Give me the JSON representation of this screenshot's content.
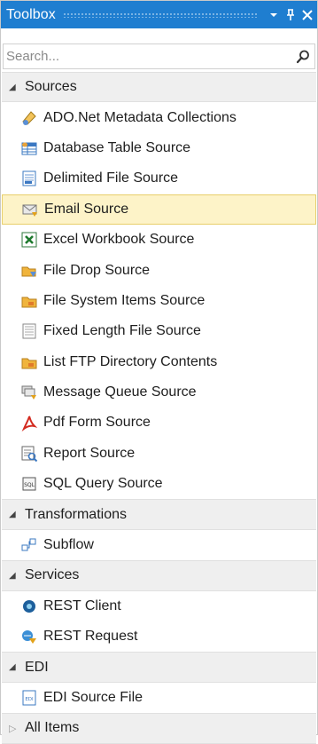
{
  "window": {
    "title": "Toolbox",
    "pin_glyph": "⭱",
    "close_glyph": "✕"
  },
  "search": {
    "placeholder": "Search..."
  },
  "colors": {
    "titlebar": "#1f7ed0",
    "selected_bg": "#fdf3c8",
    "group_bg": "#efefef"
  },
  "groups": {
    "sources": {
      "label": "Sources",
      "items": [
        {
          "label": "ADO.Net Metadata Collections",
          "icon": "ado-net-icon"
        },
        {
          "label": "Database Table Source",
          "icon": "database-table-icon"
        },
        {
          "label": "Delimited File Source",
          "icon": "delimited-file-icon"
        },
        {
          "label": "Email Source",
          "icon": "email-icon",
          "selected": true
        },
        {
          "label": "Excel Workbook Source",
          "icon": "excel-icon"
        },
        {
          "label": "File Drop Source",
          "icon": "file-drop-icon"
        },
        {
          "label": "File System Items Source",
          "icon": "folder-icon"
        },
        {
          "label": "Fixed Length File Source",
          "icon": "fixed-length-file-icon"
        },
        {
          "label": "List FTP Directory Contents",
          "icon": "ftp-folder-icon"
        },
        {
          "label": "Message Queue Source",
          "icon": "message-queue-icon"
        },
        {
          "label": "Pdf Form Source",
          "icon": "pdf-icon"
        },
        {
          "label": "Report Source",
          "icon": "report-icon"
        },
        {
          "label": "SQL Query Source",
          "icon": "sql-icon"
        }
      ]
    },
    "transformations": {
      "label": "Transformations",
      "items": [
        {
          "label": "Subflow",
          "icon": "subflow-icon"
        }
      ]
    },
    "services": {
      "label": "Services",
      "items": [
        {
          "label": "REST Client",
          "icon": "rest-client-icon"
        },
        {
          "label": "REST Request",
          "icon": "rest-request-icon"
        }
      ]
    },
    "edi": {
      "label": "EDI",
      "items": [
        {
          "label": "EDI Source File",
          "icon": "edi-file-icon"
        }
      ]
    },
    "all_items": {
      "label": "All Items"
    }
  }
}
